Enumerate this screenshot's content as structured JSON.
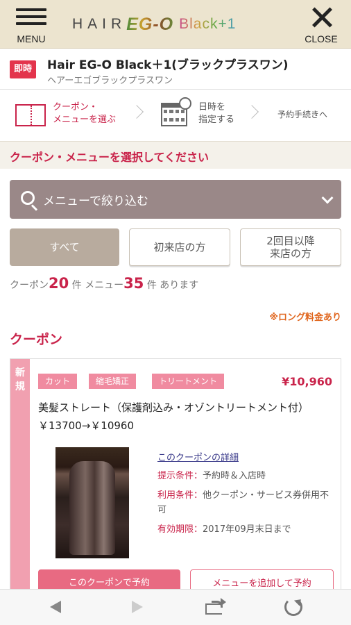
{
  "header": {
    "menu_label": "MENU",
    "close_label": "CLOSE",
    "logo": {
      "part1": "HAIR",
      "part2": "EG-O",
      "part3": "Black+1"
    }
  },
  "shop": {
    "badge": "即時",
    "name": "Hair EG-O Black＋1(ブラックプラスワン)",
    "kana": "ヘアーエゴブラックプラスワン"
  },
  "steps": [
    {
      "label": "クーポン・\nメニューを選ぶ",
      "active": true
    },
    {
      "label": "日時を\n指定する",
      "active": false
    },
    {
      "label": "予約手続きへ",
      "active": false
    }
  ],
  "section_title": "クーポン・メニューを選択してください",
  "search": {
    "label": "メニューで絞り込む"
  },
  "filters": [
    {
      "label": "すべて",
      "active": true
    },
    {
      "label": "初来店の方",
      "active": false
    },
    {
      "label": "2回目以降\n来店の方",
      "active": false
    }
  ],
  "counts": {
    "coupon_label": "クーポン",
    "coupon_count": "20",
    "coupon_unit": "件",
    "menu_label": "メニュー",
    "menu_count": "35",
    "menu_unit": "件",
    "suffix": "あります"
  },
  "long_note": "※ロング料金あり",
  "coupon_heading": "クーポン",
  "coupon": {
    "new_label": "新\n規",
    "tags": [
      "カット",
      "縮毛矯正",
      "トリートメント"
    ],
    "price": "¥10,960",
    "title": "美髪ストレート（保護剤込み・オゾントリートメント付）￥13700→￥10960",
    "detail_link": "このクーポンの詳細",
    "conditions": [
      {
        "key": "提示条件：",
        "value": "予約時＆入店時"
      },
      {
        "key": "利用条件：",
        "value": "他クーポン・サービス券併用不可"
      },
      {
        "key": "有効期限：",
        "value": "2017年09月末日まで"
      }
    ],
    "book_label": "このクーポンで予約",
    "add_label": "メニューを追加して予約"
  },
  "colors": {
    "accent": "#c9234a",
    "header_bg": "#ece4cf",
    "search_bg": "#9a8888",
    "tag_bg": "#f08ba0"
  }
}
